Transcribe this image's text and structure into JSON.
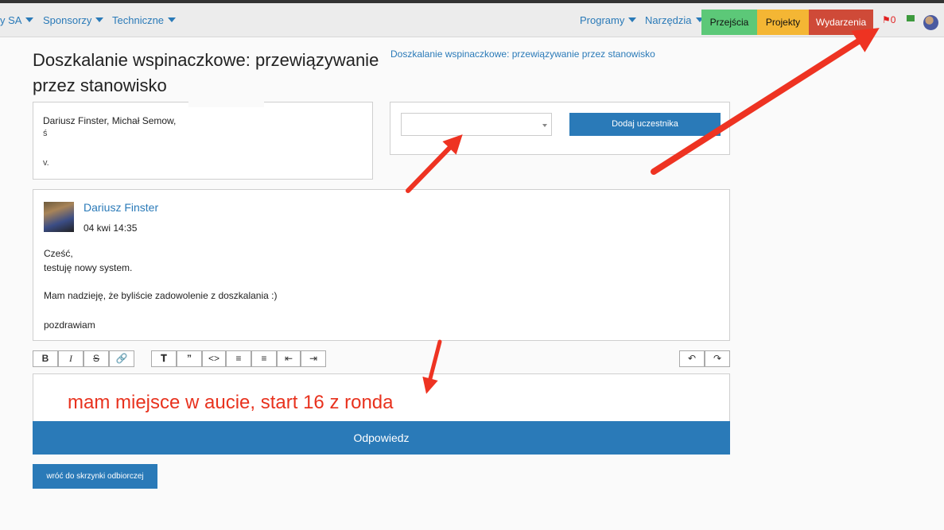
{
  "nav": {
    "left_items": [
      {
        "label": "y SA"
      },
      {
        "label": "Sponsorzy"
      },
      {
        "label": "Techniczne"
      }
    ],
    "right_items": [
      {
        "label": "Programy"
      },
      {
        "label": "Narzędzia"
      }
    ],
    "pills": [
      {
        "label": "Przejścia",
        "color": "#5cc878"
      },
      {
        "label": "Projekty",
        "color": "#f4b634"
      },
      {
        "label": "Wydarzenia",
        "color": "#cf4a38"
      }
    ],
    "flag_count": "0",
    "icons": [
      "flag-icon",
      "mail-icon",
      "user-avatar"
    ]
  },
  "page": {
    "title": "Doszkalanie wspinaczkowe: przewiązywanie przez stanowisko",
    "title_link": "Doszkalanie wspinaczkowe: przewiązywanie przez stanowisko"
  },
  "participants": {
    "names": "Dariusz Finster, Michał Semow,",
    "line2": "ś",
    "line3": "v."
  },
  "add_participant": {
    "select_value": "",
    "button_label": "Dodaj uczestnika"
  },
  "message": {
    "author": "Dariusz Finster",
    "date": "04 kwi 14:35",
    "lines": [
      "Cześć,",
      "testuję nowy system.",
      "Mam nadzieję, że byliście zadowolenie z doszkalania :)",
      "pozdrawiam"
    ]
  },
  "editor": {
    "toolbar": [
      "bold-icon",
      "italic-icon",
      "strikethrough-icon",
      "link-icon",
      "heading-icon",
      "quote-icon",
      "code-icon",
      "bullet-list-icon",
      "numbered-list-icon",
      "outdent-icon",
      "indent-icon",
      "undo-icon",
      "redo-icon"
    ],
    "content": "mam miejsce w aucie, start 16 z ronda"
  },
  "buttons": {
    "reply": "Odpowiedz",
    "back": "wróć do skrzynki odbiorczej"
  },
  "colors": {
    "accent": "#2a7ab8",
    "annotation": "#e8321e"
  }
}
